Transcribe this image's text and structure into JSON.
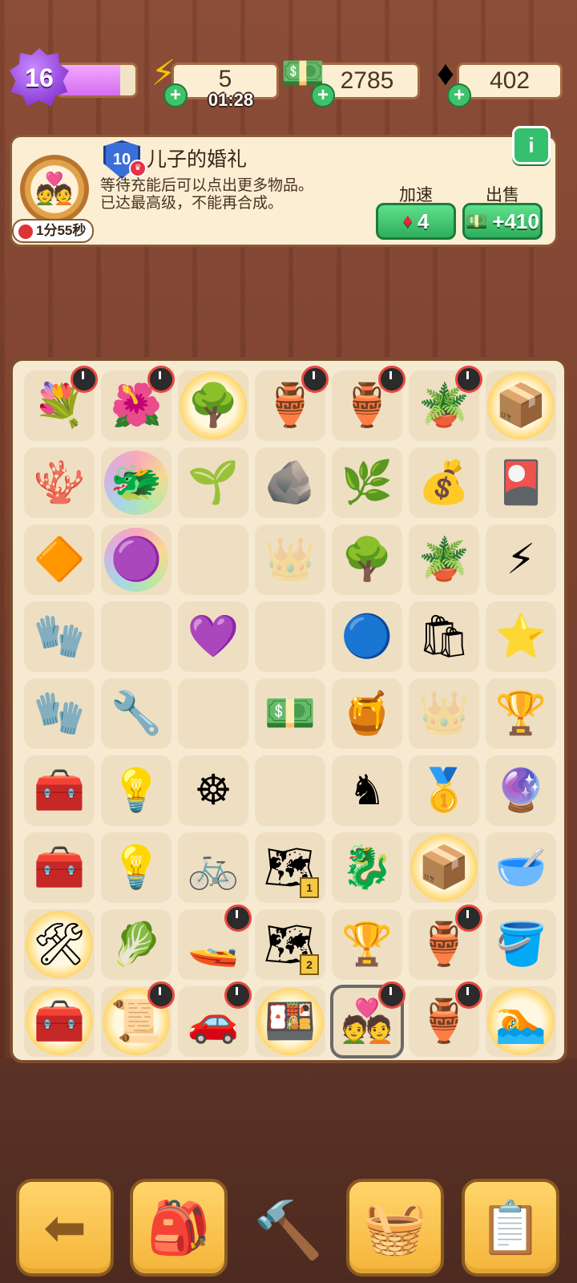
{
  "topbar": {
    "level": "16",
    "xp_progress": 0.8,
    "energy": {
      "value": "5",
      "timer": "01:28",
      "icon": "lightning-icon"
    },
    "cash": {
      "value": "2785",
      "icon": "cash-stack-icon"
    },
    "gems": {
      "value": "402",
      "icon": "ruby-gem-icon"
    }
  },
  "info": {
    "item_level": "10",
    "title": "儿子的婚礼",
    "desc_line1": "等待充能后可以点出更多物品。",
    "desc_line2": "已达最高级，不能再合成。",
    "timer": "1分55秒",
    "speedup_label": "加速",
    "speedup_cost": "4",
    "sell_label": "出售",
    "sell_value": "+410",
    "info_icon": "i"
  },
  "board": {
    "rows": [
      [
        {
          "name": "flower-bouquet",
          "glyph": "💐",
          "timer": true
        },
        {
          "name": "flower-bed",
          "glyph": "🌺",
          "timer": true
        },
        {
          "name": "blossom-tree",
          "glyph": "🌳",
          "glow": true
        },
        {
          "name": "painted-vase",
          "glyph": "🏺",
          "timer": true
        },
        {
          "name": "ornate-vase",
          "glyph": "🏺",
          "timer": true
        },
        {
          "name": "potted-shrub",
          "glyph": "🪴",
          "timer": true
        },
        {
          "name": "gift-box",
          "glyph": "📦",
          "glow": true
        }
      ],
      [
        {
          "name": "coral-branch",
          "glyph": "🪸"
        },
        {
          "name": "dragon-lion-head",
          "glyph": "🐲",
          "rainbow": true
        },
        {
          "name": "sprout-bulb",
          "glyph": "🌱"
        },
        {
          "name": "pebbles",
          "glyph": "🪨"
        },
        {
          "name": "berry-bush",
          "glyph": "🌿"
        },
        {
          "name": "seed-sack",
          "glyph": "💰"
        },
        {
          "name": "seed-packet",
          "glyph": "🎴"
        }
      ],
      [
        {
          "name": "small-gem",
          "glyph": "🔶"
        },
        {
          "name": "purple-star-blob",
          "glyph": "🟣",
          "rainbow": true
        },
        {
          "name": "empty",
          "glyph": ""
        },
        {
          "name": "empty-slot-marker",
          "glyph": "👑",
          "ghost": true
        },
        {
          "name": "bonsai-pot",
          "glyph": "🌳"
        },
        {
          "name": "plant-pot",
          "glyph": "🪴"
        },
        {
          "name": "energy-orb-orange",
          "glyph": "⚡"
        }
      ],
      [
        {
          "name": "red-gloves",
          "glyph": "🧤"
        },
        {
          "name": "empty",
          "glyph": ""
        },
        {
          "name": "purple-gem",
          "glyph": "💜"
        },
        {
          "name": "empty",
          "glyph": ""
        },
        {
          "name": "energy-orb-blue",
          "glyph": "🔵"
        },
        {
          "name": "seed-bag",
          "glyph": "🛍"
        },
        {
          "name": "star-trophy",
          "glyph": "⭐"
        }
      ],
      [
        {
          "name": "work-gloves",
          "glyph": "🧤"
        },
        {
          "name": "garden-rake",
          "glyph": "🔧"
        },
        {
          "name": "empty",
          "glyph": ""
        },
        {
          "name": "cash-stack",
          "glyph": "💵"
        },
        {
          "name": "broken-pot",
          "glyph": "🍯"
        },
        {
          "name": "empty-slot-marker",
          "glyph": "👑",
          "ghost": true
        },
        {
          "name": "glass-trophy",
          "glyph": "🏆"
        }
      ],
      [
        {
          "name": "red-toolbox",
          "glyph": "🧰"
        },
        {
          "name": "lamp-bulb",
          "glyph": "💡"
        },
        {
          "name": "wheel",
          "glyph": "☸"
        },
        {
          "name": "empty",
          "glyph": ""
        },
        {
          "name": "gold-figurine",
          "glyph": "♞"
        },
        {
          "name": "gold-statuette",
          "glyph": "🥇"
        },
        {
          "name": "crystal-ball",
          "glyph": "🔮"
        }
      ],
      [
        {
          "name": "tool-chest",
          "glyph": "🧰"
        },
        {
          "name": "lamp-set",
          "glyph": "💡"
        },
        {
          "name": "bicycle",
          "glyph": "🚲"
        },
        {
          "name": "map-pieces-1",
          "glyph": "🗺",
          "num": "1"
        },
        {
          "name": "gold-dragon-statue",
          "glyph": "🐉"
        },
        {
          "name": "pottery-box",
          "glyph": "📦",
          "glow": true
        },
        {
          "name": "gold-bowl",
          "glyph": "🥣"
        }
      ],
      [
        {
          "name": "tool-crate",
          "glyph": "🛠",
          "glow": true
        },
        {
          "name": "herb-bundle",
          "glyph": "🥬"
        },
        {
          "name": "jet-ski",
          "glyph": "🚤",
          "timer": true
        },
        {
          "name": "map-pieces-2",
          "glyph": "🗺",
          "num": "2"
        },
        {
          "name": "gold-star-trophy",
          "glyph": "🏆"
        },
        {
          "name": "pottery-crate",
          "glyph": "🏺",
          "timer": true
        },
        {
          "name": "gold-bucket",
          "glyph": "🪣"
        }
      ],
      [
        {
          "name": "toolbox-glow",
          "glyph": "🧰",
          "glow": true
        },
        {
          "name": "map-scroll",
          "glyph": "📜",
          "glow": true,
          "timer": true
        },
        {
          "name": "purple-car",
          "glyph": "🚗",
          "timer": true
        },
        {
          "name": "picnic-table",
          "glyph": "🍱",
          "glow": true
        },
        {
          "name": "wedding-portrait",
          "glyph": "💑",
          "selected": true,
          "timer": true
        },
        {
          "name": "vase-crate",
          "glyph": "🏺",
          "timer": true
        },
        {
          "name": "pool-set",
          "glyph": "🏊",
          "glow": true
        }
      ]
    ]
  },
  "nav": {
    "back_icon": "arrow-left-icon",
    "bag_icon": "backpack-icon",
    "tool_icon": "trowel-icon",
    "shop_icon": "basket-icon",
    "tasks_icon": "clipboard-star-icon"
  }
}
